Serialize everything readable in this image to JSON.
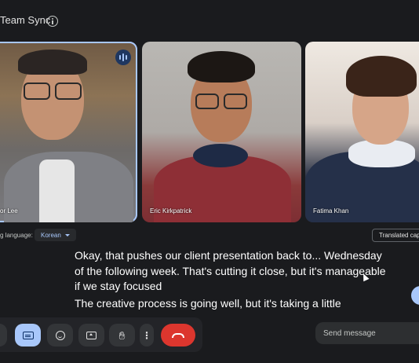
{
  "meeting": {
    "title": "Team Sync"
  },
  "participants": [
    {
      "name": "or Lee",
      "speaking": true
    },
    {
      "name": "Eric Kirkpatrick",
      "speaking": false
    },
    {
      "name": "Fatima Khan",
      "speaking": false
    }
  ],
  "language_bar": {
    "label": "g language:",
    "selected": "Korean",
    "translated_captions": "Translated captions"
  },
  "captions": [
    "Okay, that pushes our client presentation back to... Wednesday of the following week. That's cutting it close, but it's manageable if we stay focused",
    "The creative process is going well, but it's taking a little"
  ],
  "chat": {
    "placeholder": "Send message"
  },
  "colors": {
    "accent": "#a8c7fa",
    "end_call": "#dc362e",
    "background": "#1a1b1e"
  },
  "controls": [
    {
      "icon": "partial-icon"
    },
    {
      "icon": "captions-icon",
      "active": true
    },
    {
      "icon": "emoji-icon"
    },
    {
      "icon": "present-icon"
    },
    {
      "icon": "raise-hand-icon"
    },
    {
      "icon": "more-options-icon"
    },
    {
      "icon": "end-call-icon"
    }
  ]
}
